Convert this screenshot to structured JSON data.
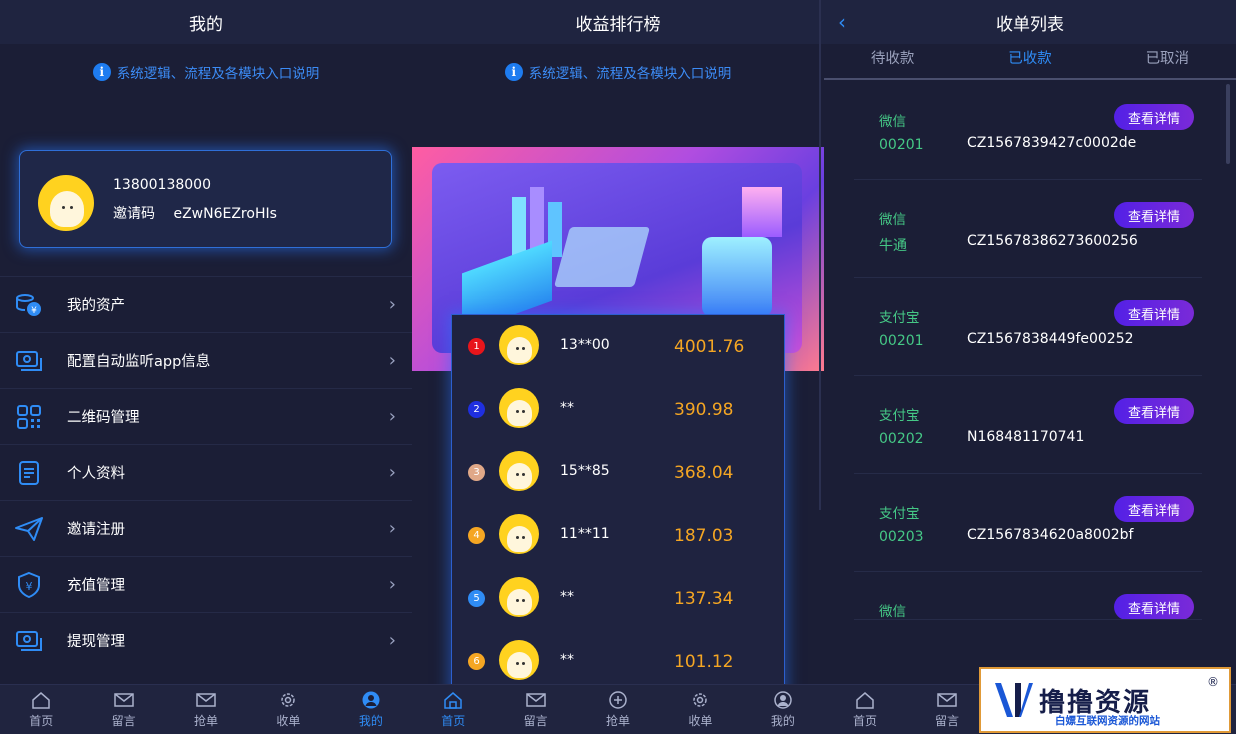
{
  "panel1": {
    "title": "我的",
    "notice": "系统逻辑、流程及各模块入口说明",
    "profile": {
      "phone": "13800138000",
      "invite_label": "邀请码",
      "invite_code": "eZwN6EZroHIs"
    },
    "menu": [
      {
        "label": "我的资产",
        "icon": "coins-icon"
      },
      {
        "label": "配置自动监听app信息",
        "icon": "cash-icon"
      },
      {
        "label": "二维码管理",
        "icon": "qrcode-icon"
      },
      {
        "label": "个人资料",
        "icon": "document-icon"
      },
      {
        "label": "邀请注册",
        "icon": "send-icon"
      },
      {
        "label": "充值管理",
        "icon": "yen-shield-icon"
      },
      {
        "label": "提现管理",
        "icon": "cash-icon"
      }
    ],
    "tabs": [
      {
        "label": "首页",
        "icon": "home-icon"
      },
      {
        "label": "留言",
        "icon": "mail-icon"
      },
      {
        "label": "抢单",
        "icon": "mail-icon"
      },
      {
        "label": "收单",
        "icon": "gear-icon"
      },
      {
        "label": "我的",
        "icon": "user-icon",
        "active": true
      }
    ]
  },
  "panel2": {
    "title": "收益排行榜",
    "notice": "系统逻辑、流程及各模块入口说明",
    "ranks": [
      {
        "rank": "1",
        "name": "13**00",
        "amount": "4001.76",
        "color": "#e8151b"
      },
      {
        "rank": "2",
        "name": "**",
        "amount": "390.98",
        "color": "#1f2fe0"
      },
      {
        "rank": "3",
        "name": "15**85",
        "amount": "368.04",
        "color": "#e0a888"
      },
      {
        "rank": "4",
        "name": "11**11",
        "amount": "187.03",
        "color": "#f5a623"
      },
      {
        "rank": "5",
        "name": "**",
        "amount": "137.34",
        "color": "#2f8cf5"
      },
      {
        "rank": "6",
        "name": "**",
        "amount": "101.12",
        "color": "#f5a623"
      }
    ],
    "tabs": [
      {
        "label": "首页",
        "icon": "home-icon",
        "active": true
      },
      {
        "label": "留言",
        "icon": "mail-icon"
      },
      {
        "label": "抢单",
        "icon": "plus-circle-icon"
      },
      {
        "label": "收单",
        "icon": "gear-icon"
      },
      {
        "label": "我的",
        "icon": "user-icon"
      }
    ]
  },
  "panel3": {
    "title": "收单列表",
    "subtabs": [
      "待收款",
      "已收款",
      "已取消"
    ],
    "active_subtab": "已收款",
    "button_label": "查看详情",
    "orders": [
      {
        "type": "微信",
        "id": "00201",
        "no": "CZ1567839427c0002de"
      },
      {
        "type": "微信",
        "id": "牛通",
        "no": "CZ15678386273600256"
      },
      {
        "type": "支付宝",
        "id": "00201",
        "no": "CZ1567838449fe00252"
      },
      {
        "type": "支付宝",
        "id": "00202",
        "no": "N168481170741"
      },
      {
        "type": "支付宝",
        "id": "00203",
        "no": "CZ1567834620a8002bf"
      },
      {
        "type": "微信",
        "id": "",
        "no": ""
      }
    ],
    "tabs": [
      {
        "label": "首页",
        "icon": "home-icon"
      },
      {
        "label": "留言",
        "icon": "mail-icon"
      }
    ]
  },
  "watermark": {
    "title": "撸撸资源",
    "subtitle": "白嫖互联网资源的网站",
    "reg": "®"
  }
}
